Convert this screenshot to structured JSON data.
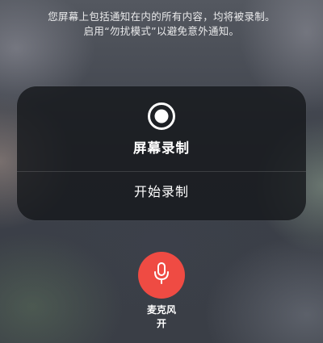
{
  "notice": {
    "line1": "您屏幕上包括通知在内的所有内容，均将被录制。",
    "line2": "启用“勿扰模式”以避免意外通知。"
  },
  "recording_card": {
    "title": "屏幕录制",
    "icon": "record-icon",
    "start_button_label": "开始录制"
  },
  "microphone": {
    "label": "麦克风",
    "state": "开",
    "icon": "microphone-icon",
    "accent_color": "#ef4b43"
  }
}
